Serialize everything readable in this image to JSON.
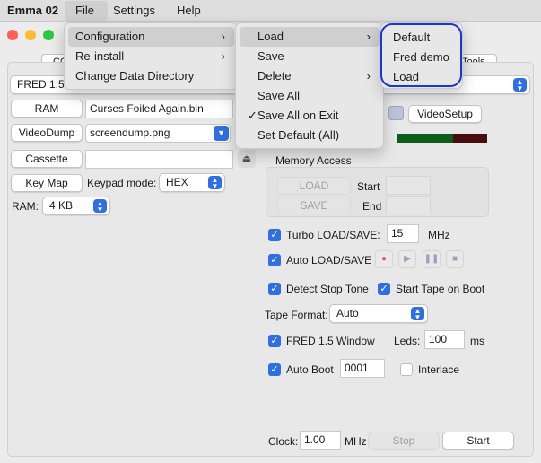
{
  "menubar": {
    "app": "Emma 02",
    "items": [
      "File",
      "Settings",
      "Help"
    ]
  },
  "tabs": {
    "left_partial": "CO",
    "right_partial": "Tools"
  },
  "computer_select": "FRED 1.5",
  "ram": {
    "button": "RAM",
    "file": "Curses Foiled Again.bin"
  },
  "videodump": {
    "button": "VideoDump",
    "file": "screendump.png"
  },
  "cassette": {
    "button": "Cassette",
    "file": ""
  },
  "keymap": {
    "button": "Key Map",
    "mode_label": "Keypad mode:",
    "mode_value": "HEX"
  },
  "ram_size": {
    "label": "RAM:",
    "value": "4 KB"
  },
  "video_setup": "VideoSetup",
  "memory_access": {
    "title": "Memory Access",
    "load": "LOAD",
    "save": "SAVE",
    "start_label": "Start",
    "end_label": "End"
  },
  "turbo": {
    "label": "Turbo LOAD/SAVE:",
    "value": "15",
    "unit": "MHz",
    "checked": true
  },
  "auto_load": {
    "label": "Auto LOAD/SAVE",
    "checked": true
  },
  "detect_stop": {
    "label": "Detect Stop Tone",
    "checked": true
  },
  "start_tape": {
    "label": "Start Tape on Boot",
    "checked": true
  },
  "tape_format": {
    "label": "Tape Format:",
    "value": "Auto"
  },
  "fred_window": {
    "label": "FRED 1.5 Window",
    "checked": true
  },
  "leds": {
    "label": "Leds:",
    "value": "100",
    "unit": "ms"
  },
  "auto_boot": {
    "label": "Auto Boot",
    "value": "0001",
    "checked": true
  },
  "interlace": {
    "label": "Interlace",
    "checked": false
  },
  "clock": {
    "label": "Clock:",
    "value": "1.00",
    "unit": "MHz"
  },
  "stop_button": "Stop",
  "start_button": "Start",
  "file_menu": [
    "Configuration",
    "Re-install",
    "Change Data Directory"
  ],
  "configuration_menu": [
    "Load",
    "Save",
    "Delete",
    "Save All",
    "Save All on Exit",
    "Set Default (All)"
  ],
  "load_menu": [
    "Default",
    "Fred demo",
    "Load"
  ],
  "colors": {
    "accent": "#2f6fe4",
    "highlight_outline": "#1b35d8",
    "led_green": "#0d5c1a",
    "led_red": "#4a0d0d"
  }
}
